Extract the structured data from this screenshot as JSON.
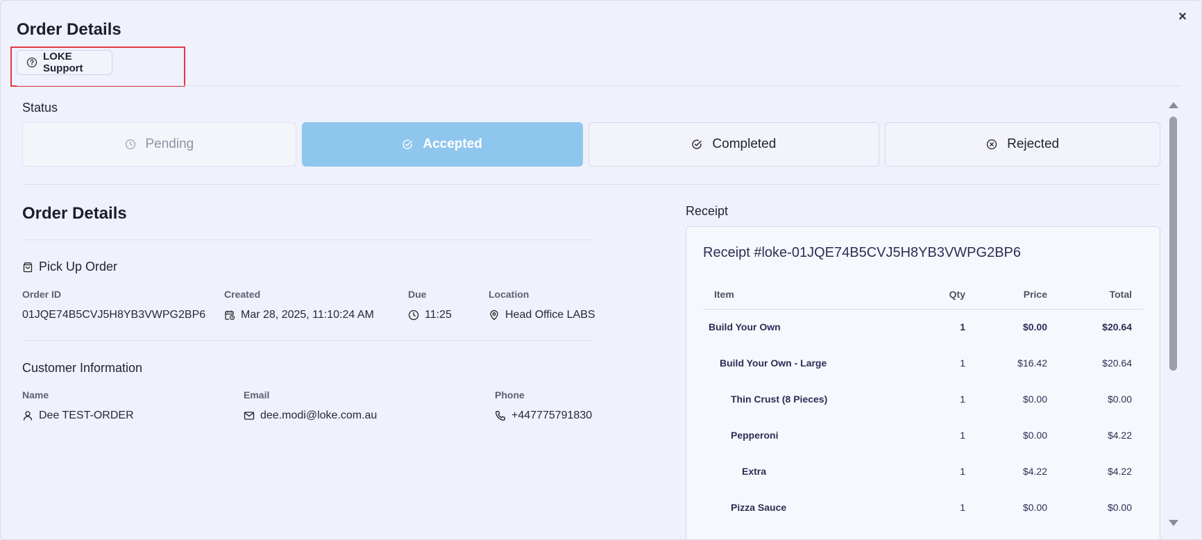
{
  "modal": {
    "title": "Order Details",
    "close_label": "×",
    "support_button_label": "LOKE Support"
  },
  "status": {
    "label": "Status",
    "options": [
      {
        "label": "Pending",
        "icon": "clock-icon"
      },
      {
        "label": "Accepted",
        "icon": "check-circle-icon",
        "selected": true
      },
      {
        "label": "Completed",
        "icon": "check-circle-icon"
      },
      {
        "label": "Rejected",
        "icon": "x-circle-icon"
      }
    ],
    "selected_color": "#8fc6ed"
  },
  "order": {
    "section_title": "Order Details",
    "type_label": "Pick Up Order",
    "fields": {
      "order_id_label": "Order ID",
      "order_id": "01JQE74B5CVJ5H8YB3VWPG2BP6",
      "created_label": "Created",
      "created": "Mar 28, 2025, 11:10:24 AM",
      "due_label": "Due",
      "due": "11:25",
      "location_label": "Location",
      "location": "Head Office LABS"
    }
  },
  "customer": {
    "section_title": "Customer Information",
    "name_label": "Name",
    "name": "Dee TEST-ORDER",
    "email_label": "Email",
    "email": "dee.modi@loke.com.au",
    "phone_label": "Phone",
    "phone": "+447775791830"
  },
  "receipt": {
    "label": "Receipt",
    "title": "Receipt #loke-01JQE74B5CVJ5H8YB3VWPG2BP6",
    "columns": [
      "Item",
      "Qty",
      "Price",
      "Total"
    ],
    "rows": [
      {
        "item": "Build Your Own",
        "qty": "1",
        "price": "$0.00",
        "total": "$20.64",
        "level": 0
      },
      {
        "item": "Build Your Own - Large",
        "qty": "1",
        "price": "$16.42",
        "total": "$20.64",
        "level": 1
      },
      {
        "item": "Thin Crust (8 Pieces)",
        "qty": "1",
        "price": "$0.00",
        "total": "$0.00",
        "level": 2
      },
      {
        "item": "Pepperoni",
        "qty": "1",
        "price": "$0.00",
        "total": "$4.22",
        "level": 2
      },
      {
        "item": "Extra",
        "qty": "1",
        "price": "$4.22",
        "total": "$4.22",
        "level": 3
      },
      {
        "item": "Pizza Sauce",
        "qty": "1",
        "price": "$0.00",
        "total": "$0.00",
        "level": 2
      }
    ]
  }
}
